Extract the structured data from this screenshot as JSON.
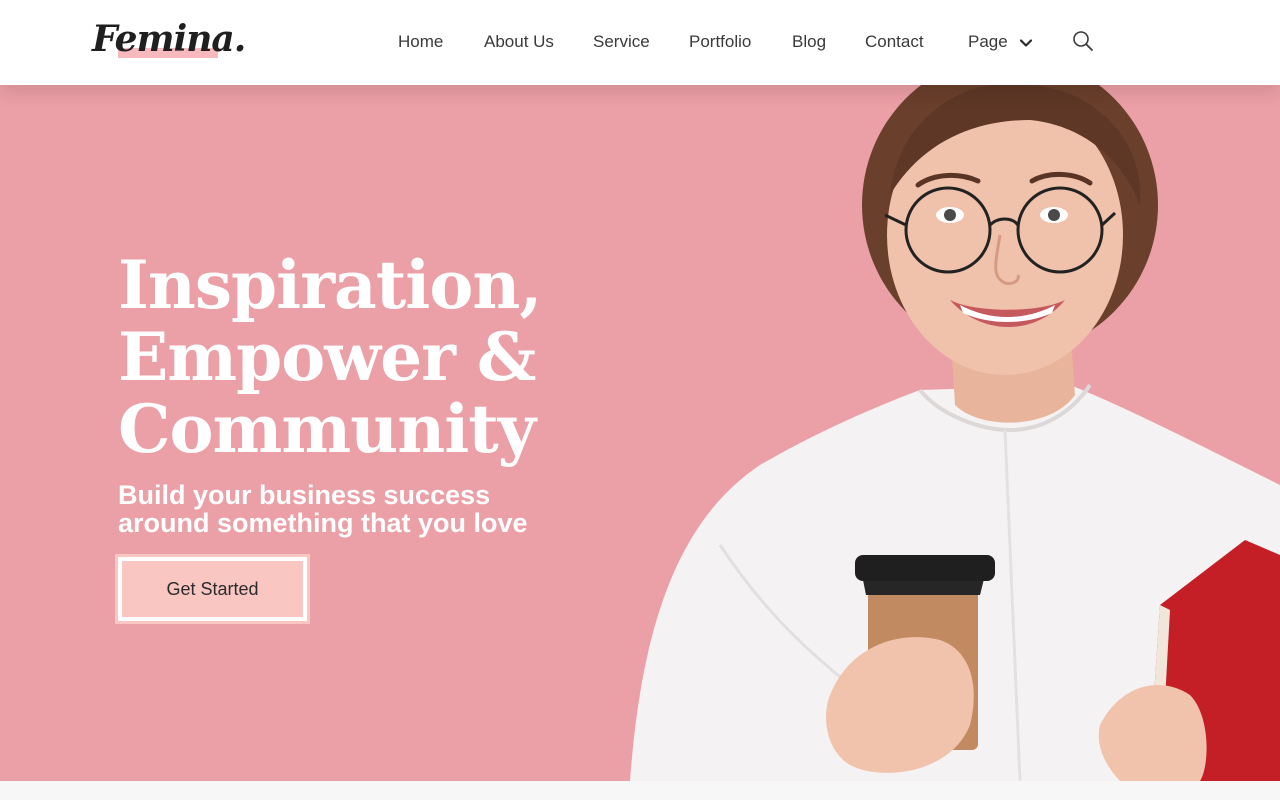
{
  "brand": {
    "logo_text": "Femina.",
    "accent": "#f6b9bd",
    "hero_bg": "#eb9fa6"
  },
  "nav": {
    "items": [
      {
        "label": "Home"
      },
      {
        "label": "About Us"
      },
      {
        "label": "Service"
      },
      {
        "label": "Portfolio"
      },
      {
        "label": "Blog"
      },
      {
        "label": "Contact"
      },
      {
        "label": "Page"
      }
    ],
    "page_dropdown_icon": "chevron-down-icon",
    "search_icon": "search-icon"
  },
  "hero": {
    "headline_line1": "Inspiration,",
    "headline_line2": "Empower &",
    "headline_line3": "Community",
    "subhead_line1": "Build your business success",
    "subhead_line2": "around something that you love",
    "cta_label": "Get Started",
    "cta_color": "#f9c6c2"
  }
}
